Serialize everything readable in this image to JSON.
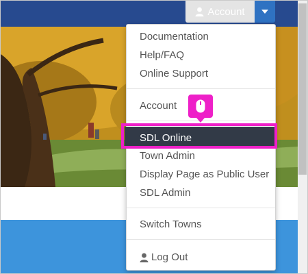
{
  "header": {
    "account_label": "Account"
  },
  "menu": {
    "items": [
      {
        "label": "Documentation"
      },
      {
        "label": "Help/FAQ"
      },
      {
        "label": "Online Support"
      },
      {
        "label": "Account"
      },
      {
        "label": "SDL Online"
      },
      {
        "label": "Town Admin"
      },
      {
        "label": "Display Page as Public User"
      },
      {
        "label": "SDL Admin"
      },
      {
        "label": "Switch Towns"
      },
      {
        "label": "Log Out"
      }
    ],
    "active_item": "SDL Online"
  },
  "colors": {
    "header_bar": "#274a8f",
    "accent": "#2f72c2",
    "active_item_bg": "#323a47",
    "highlight_border": "#ee20c8",
    "blue_band": "#3d94dc"
  },
  "icons": {
    "account": "user-icon",
    "dropdown": "caret-down-icon",
    "cursor": "mouse-icon",
    "logout": "user-icon"
  }
}
